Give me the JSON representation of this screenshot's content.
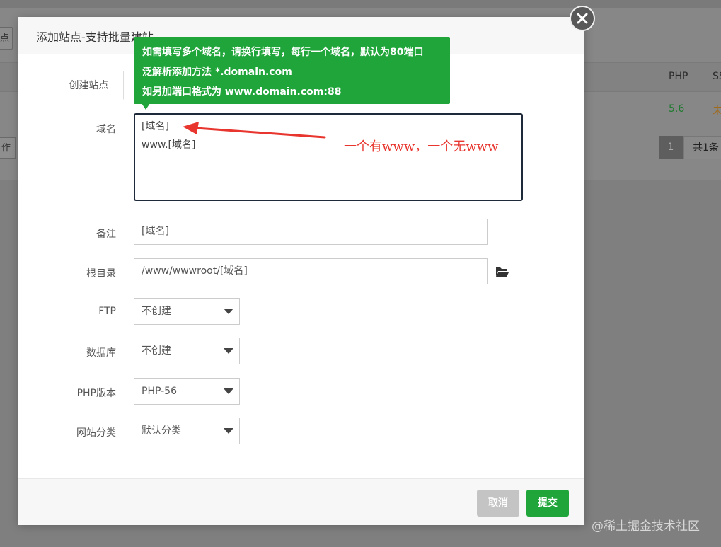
{
  "background": {
    "left_button": "点",
    "table_headers": [
      "PHP",
      "SS"
    ],
    "row": {
      "php": "5.6",
      "ssl": "未"
    },
    "left_button_2": "作",
    "pager": {
      "current": "1",
      "total": "共1条"
    }
  },
  "modal": {
    "title": "添加站点-支持批量建站",
    "tabs": [
      {
        "label": "创建站点"
      }
    ],
    "tooltip": {
      "lines": [
        "如需填写多个域名，请换行填写，每行一个域名，默认为80端口",
        "泛解析添加方法 *.domain.com",
        "如另加端口格式为 www.domain.com:88"
      ]
    },
    "form": {
      "domain": {
        "label": "域名",
        "value": "[域名]\nwww.[域名]"
      },
      "remark": {
        "label": "备注",
        "value": "[域名]"
      },
      "root": {
        "label": "根目录",
        "value": "/www/wwwroot/[域名]"
      },
      "ftp": {
        "label": "FTP",
        "value": "不创建"
      },
      "database": {
        "label": "数据库",
        "value": "不创建"
      },
      "php": {
        "label": "PHP版本",
        "value": "PHP-56"
      },
      "category": {
        "label": "网站分类",
        "value": "默认分类"
      }
    },
    "footer": {
      "cancel": "取消",
      "submit": "提交"
    }
  },
  "annotation": {
    "text": "一个有www，一个无www",
    "color": "#e8362f"
  },
  "watermark": "@稀土掘金技术社区",
  "colors": {
    "accent": "#20a53a",
    "cancel": "#c4c4c4"
  },
  "icons": {
    "close": "close-icon",
    "folder": "folder-open-icon",
    "select": "chevron-down-icon"
  }
}
